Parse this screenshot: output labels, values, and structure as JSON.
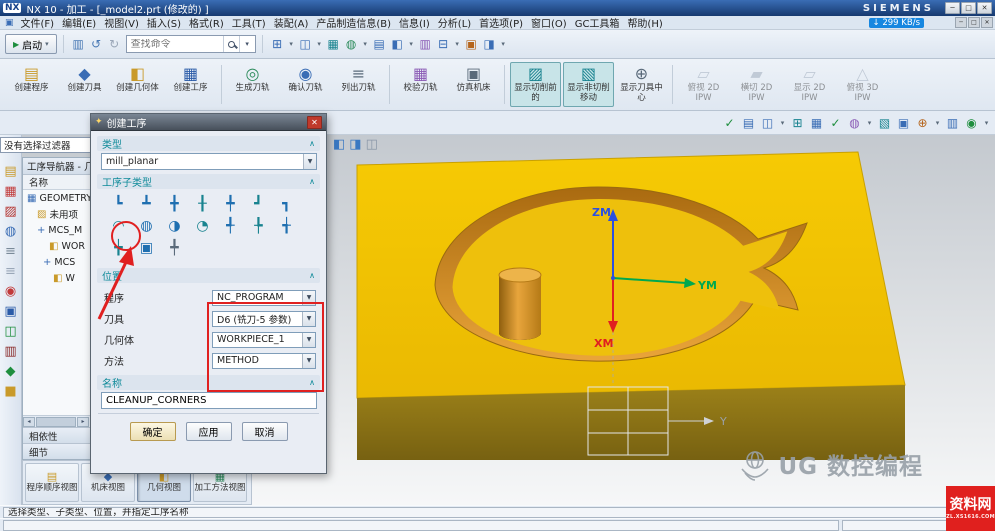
{
  "ui": {
    "caret": "▾",
    "combo_arrow": "▼",
    "chevron": "∧",
    "menu_icon": "▣",
    "start_icon": "▶",
    "scroll_left": "◂",
    "scroll_right": "▸"
  },
  "colors": {
    "accent_teal": "#0e8a99",
    "annotation_red": "#e02020",
    "block_top": "#f2c202",
    "block_front": "#8f7514",
    "pocket_wall": "#c98118",
    "badge_red": "#e0201e"
  },
  "titlebar": {
    "logo": "NX",
    "title": "NX 10 - 加工 - [_model2.prt (修改的) ]",
    "brand": "SIEMENS",
    "min": "─",
    "max": "□",
    "close": "✕"
  },
  "menubar": {
    "items": [
      "文件(F)",
      "编辑(E)",
      "视图(V)",
      "插入(S)",
      "格式(R)",
      "工具(T)",
      "装配(A)",
      "产品制造信息(B)",
      "信息(I)",
      "分析(L)",
      "首选项(P)",
      "窗口(O)",
      "GC工具箱",
      "帮助(H)"
    ],
    "badge": "↓ 299 KB/s",
    "min": "─",
    "max": "□",
    "close": "✕"
  },
  "toolbar": {
    "start_label": "启动",
    "search_placeholder": "查找命令",
    "left_icons": [
      {
        "g": "▥",
        "c": "#4a7ab5",
        "n": "save-icon"
      },
      {
        "g": "↺",
        "c": "#4a7ab5",
        "n": "undo-icon"
      },
      {
        "g": "↻",
        "c": "#9aa7b8",
        "n": "redo-icon"
      }
    ],
    "right_icons": [
      {
        "g": "⊞",
        "c": "#3a6db5",
        "n": "window-icon"
      },
      {
        "g": "▾",
        "c": "#5a6a7a",
        "n": "dropdown-caret",
        "cls": "caret"
      },
      {
        "g": "◫",
        "c": "#3a6db5",
        "n": "view-layout-icon"
      },
      {
        "g": "▾",
        "c": "#5a6a7a",
        "n": "dropdown-caret",
        "cls": "caret"
      },
      {
        "g": "▦",
        "c": "#18838f",
        "n": "palette-icon"
      },
      {
        "g": "◍",
        "c": "#2a8a5a",
        "n": "render-style-icon"
      },
      {
        "g": "▾",
        "c": "#5a6a7a",
        "n": "dropdown-caret",
        "cls": "caret"
      },
      {
        "g": "▤",
        "c": "#3a6db5",
        "n": "layer-icon"
      },
      {
        "g": "◧",
        "c": "#3a6db5",
        "n": "split-view-icon"
      },
      {
        "g": "▾",
        "c": "#5a6a7a",
        "n": "dropdown-caret",
        "cls": "caret"
      },
      {
        "g": "▥",
        "c": "#8a5ab5",
        "n": "grid-icon"
      },
      {
        "g": "⊟",
        "c": "#3a6db5",
        "n": "pane-icon"
      },
      {
        "g": "▾",
        "c": "#5a6a7a",
        "n": "dropdown-caret",
        "cls": "caret"
      },
      {
        "g": "▣",
        "c": "#b5651d",
        "n": "material-icon"
      },
      {
        "g": "◨",
        "c": "#3a6db5",
        "n": "window-split-icon"
      },
      {
        "g": "▾",
        "c": "#5a6a7a",
        "n": "dropdown-caret",
        "cls": "caret"
      }
    ]
  },
  "ribbon": {
    "g1": [
      {
        "label": "创建程序",
        "g": "▤",
        "c": "#c99a2a",
        "n": "create-program-button"
      },
      {
        "label": "创建刀具",
        "g": "◆",
        "c": "#3a6db5",
        "n": "create-tool-button"
      },
      {
        "label": "创建几何体",
        "g": "◧",
        "c": "#c99a2a",
        "n": "create-geometry-button"
      },
      {
        "label": "创建工序",
        "g": "▦",
        "c": "#2a5ba8",
        "n": "create-operation-button"
      }
    ],
    "g2": [
      {
        "label": "生成刀轨",
        "g": "◎",
        "c": "#2a8a5a",
        "n": "generate-toolpath-button"
      },
      {
        "label": "确认刀轨",
        "g": "◉",
        "c": "#3a6db5",
        "n": "verify-toolpath-button"
      },
      {
        "label": "列出刀轨",
        "g": "≡",
        "c": "#5a6a7a",
        "n": "list-toolpath-button"
      }
    ],
    "g3": [
      {
        "label": "校验刀轨",
        "g": "▦",
        "c": "#8a5ab5",
        "n": "check-toolpath-button"
      },
      {
        "label": "仿真机床",
        "g": "▣",
        "c": "#5a6a7a",
        "n": "simulate-machine-button"
      }
    ],
    "g4": [
      {
        "label": "显示切削前的",
        "g": "▨",
        "c": "#18838f",
        "cls": "active",
        "n": "show-before-cut-button"
      },
      {
        "label": "显示非切削移动",
        "g": "▧",
        "c": "#18838f",
        "cls": "active",
        "n": "show-non-cutting-moves-button"
      },
      {
        "label": "显示刀具中心",
        "g": "⊕",
        "c": "#5a6a7a",
        "n": "show-tool-center-button"
      }
    ],
    "g5": [
      {
        "label": "俯视 2D IPW",
        "g": "▱",
        "c": "#9aa7b8",
        "cls": "disabled",
        "n": "top-2d-ipw-button"
      },
      {
        "label": "横切 2D IPW",
        "g": "▰",
        "c": "#9aa7b8",
        "cls": "disabled",
        "n": "section-2d-ipw-button"
      },
      {
        "label": "显示 2D IPW",
        "g": "▱",
        "c": "#9aa7b8",
        "cls": "disabled",
        "n": "show-2d-ipw-button"
      },
      {
        "label": "俯视 3D IPW",
        "g": "△",
        "c": "#9aa7b8",
        "cls": "disabled",
        "n": "top-3d-ipw-button"
      }
    ]
  },
  "selbar": {
    "icons": [
      {
        "g": "✓",
        "c": "#1e8e3e",
        "n": "approve-icon"
      },
      {
        "g": "▤",
        "c": "#3a6db5",
        "n": "list-icon"
      },
      {
        "g": "◫",
        "c": "#3a6db5",
        "n": "columns-icon"
      },
      {
        "g": "▾",
        "c": "#5a6a7a",
        "n": "dropdown-caret",
        "cls": "caret"
      },
      {
        "g": "⊞",
        "c": "#18838f",
        "n": "grid-icon"
      },
      {
        "g": "▦",
        "c": "#3a6db5",
        "n": "table-icon"
      },
      {
        "g": "✓",
        "c": "#1e8e3e",
        "n": "check-icon"
      },
      {
        "g": "◍",
        "c": "#8a5ab5",
        "n": "sphere-icon"
      },
      {
        "g": "▾",
        "c": "#5a6a7a",
        "n": "dropdown-caret",
        "cls": "caret"
      },
      {
        "g": "▧",
        "c": "#18838f",
        "n": "hatch-icon"
      },
      {
        "g": "▣",
        "c": "#3a6db5",
        "n": "frame-icon"
      },
      {
        "g": "⊕",
        "c": "#b5651d",
        "n": "target-icon"
      },
      {
        "g": "▾",
        "c": "#5a6a7a",
        "n": "dropdown-caret",
        "cls": "caret"
      },
      {
        "g": "▥",
        "c": "#3a6db5",
        "n": "rows-icon"
      },
      {
        "g": "◉",
        "c": "#1e8e3e",
        "n": "point-icon"
      },
      {
        "g": "▾",
        "c": "#5a6a7a",
        "n": "dropdown-caret",
        "cls": "caret"
      }
    ]
  },
  "selection_bar": {
    "filter": "没有选择过滤器"
  },
  "leftstrip": {
    "icons": [
      {
        "g": "▤",
        "c": "#c99a2a",
        "n": "roles-icon"
      },
      {
        "g": "▦",
        "c": "#c23a3a",
        "n": "assembly-icon"
      },
      {
        "g": "▨",
        "c": "#b5332f",
        "n": "constraint-icon"
      },
      {
        "g": "◍",
        "c": "#3a6db5",
        "n": "move-icon"
      },
      {
        "g": "≡",
        "c": "#7a8a99",
        "n": "history-icon"
      },
      {
        "g": "≡",
        "c": "#9aa7b8",
        "n": "outline-icon"
      },
      {
        "g": "◉",
        "c": "#c23a3a",
        "n": "record-icon"
      },
      {
        "g": "▣",
        "c": "#2a5ba8",
        "n": "frame-icon"
      },
      {
        "g": "◫",
        "c": "#1e8e3e",
        "n": "panel-icon"
      },
      {
        "g": "▥",
        "c": "#8a2a2a",
        "n": "rows-icon"
      },
      {
        "g": "◆",
        "c": "#1e8e3e",
        "n": "diamond-icon"
      },
      {
        "g": "■",
        "c": "#c99a2a",
        "n": "block-icon"
      }
    ]
  },
  "navigator": {
    "title": "工序导航器 - 几...",
    "column": "名称",
    "rows": [
      {
        "g": "▦",
        "c": "#3a6db5",
        "label": "GEOMETRY",
        "pad": 4,
        "n": "tree-item-geometry"
      },
      {
        "g": "▨",
        "c": "#c99a2a",
        "label": "未用项",
        "pad": 14,
        "n": "tree-item-unused"
      },
      {
        "g": "+",
        "c": "#3a6db5",
        "label": "MCS_M",
        "pad": 14,
        "n": "tree-item-mcs-mill"
      },
      {
        "g": "◧",
        "c": "#c99a2a",
        "label": "WOR",
        "pad": 26,
        "n": "tree-item-workpiece"
      },
      {
        "g": "+",
        "c": "#3a6db5",
        "label": "MCS",
        "pad": 20,
        "n": "tree-item-mcs"
      },
      {
        "g": "◧",
        "c": "#c99a2a",
        "label": "W",
        "pad": 30,
        "n": "tree-item-workpiece-2"
      }
    ],
    "sections": [
      {
        "label": "相依性"
      },
      {
        "label": "细节"
      }
    ]
  },
  "tabs": [
    {
      "label": "程序顺序视图",
      "g": "▤",
      "c": "#c99a2a",
      "n": "tab-program-order-view"
    },
    {
      "label": "机床视图",
      "g": "◆",
      "c": "#3a6db5",
      "n": "tab-machine-tool-view"
    },
    {
      "label": "几何视图",
      "g": "◧",
      "c": "#c99a2a",
      "cls": "active",
      "n": "tab-geometry-view"
    },
    {
      "label": "加工方法视图",
      "g": "▦",
      "c": "#2a8a5a",
      "n": "tab-machining-method-view"
    }
  ],
  "dialog": {
    "title": "创建工序",
    "gear": "✦",
    "close": "✕",
    "sections": {
      "type": "类型",
      "subtype": "工序子类型",
      "location": "位置",
      "name": "名称"
    },
    "type_value": "mill_planar",
    "subtype_icons": [
      {
        "g": "┗",
        "c": "#1f6fb0",
        "n": "subtype-floor-wall-icon"
      },
      {
        "g": "┻",
        "c": "#1f6fb0",
        "n": "subtype-face-mill-icon"
      },
      {
        "g": "╋",
        "c": "#1f6fb0",
        "n": "subtype-planar-mill-icon"
      },
      {
        "g": "╂",
        "c": "#18838f",
        "n": "subtype-rough-follow-icon"
      },
      {
        "g": "╇",
        "c": "#1f6fb0",
        "n": "subtype-rough-zigzag-icon"
      },
      {
        "g": "┛",
        "c": "#18838f",
        "n": "subtype-cleanup-icon"
      },
      {
        "g": "┓",
        "c": "#1f6fb0",
        "n": "subtype-finish-walls-icon"
      },
      {
        "g": "◠",
        "c": "#18838f",
        "n": "subtype-planar-profile-icon"
      },
      {
        "g": "◍",
        "c": "#1f6fb0",
        "n": "subtype-rough-icon"
      },
      {
        "g": "◑",
        "c": "#1f6fb0",
        "n": "subtype-finish-floor-icon"
      },
      {
        "g": "◔",
        "c": "#18838f",
        "n": "subtype-engrave-icon"
      },
      {
        "g": "╃",
        "c": "#1f6fb0",
        "n": "subtype-drill-icon"
      },
      {
        "g": "╄",
        "c": "#18838f",
        "n": "subtype-thread-mill-icon"
      },
      {
        "g": "╅",
        "c": "#1f6fb0",
        "n": "subtype-hole-mill-icon"
      },
      {
        "g": "╈",
        "c": "#18838f",
        "n": "subtype-text-icon"
      },
      {
        "g": "▣",
        "c": "#1f6fb0",
        "n": "subtype-user-defined-icon"
      },
      {
        "g": "╇",
        "c": "#5a6a7a",
        "n": "subtype-mill-control-icon"
      }
    ],
    "location_rows": [
      {
        "label": "程序",
        "value": "NC_PROGRAM"
      },
      {
        "label": "刀具",
        "value": "D6 (铣刀-5 参数)"
      },
      {
        "label": "几何体",
        "value": "WORKPIECE_1"
      },
      {
        "label": "方法",
        "value": "METHOD"
      }
    ],
    "name_value": "CLEANUP_CORNERS",
    "buttons": {
      "ok": "确定",
      "apply": "应用",
      "cancel": "取消"
    }
  },
  "viewport": {
    "axes": {
      "z": "ZM",
      "y": "YM",
      "x": "XM"
    },
    "wcs_axis": "Y",
    "watermark": "UG 数控编程",
    "badge": {
      "title": "资料网",
      "sub": "ZL.XS1616.COM"
    },
    "cubes": [
      {
        "g": "◧",
        "c": "#3a78c2",
        "n": "view-cube-icon"
      },
      {
        "g": "◨",
        "c": "#3a78c2",
        "n": "view-cube-icon"
      },
      {
        "g": "◫",
        "c": "#8a97a8",
        "n": "view-cube-icon"
      }
    ]
  },
  "statusbar": {
    "message": "选择类型、子类型、位置，并指定工序名称"
  }
}
